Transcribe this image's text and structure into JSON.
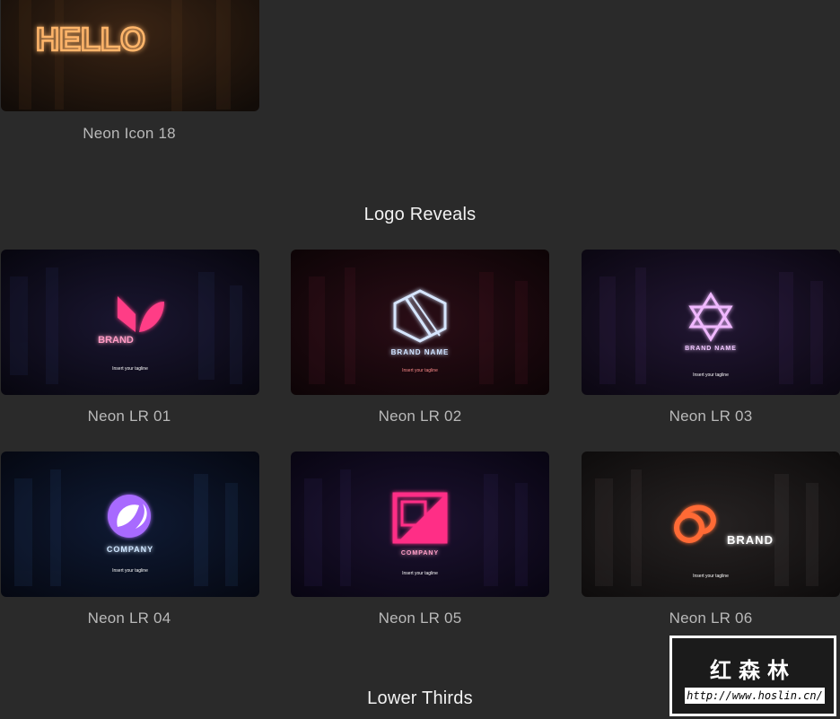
{
  "top_item": {
    "caption": "Neon Icon 18",
    "neon_text": "HELLO"
  },
  "sections": {
    "logo_reveals": "Logo Reveals",
    "lower_thirds": "Lower Thirds"
  },
  "items": [
    {
      "caption": "Neon LR 01",
      "brand": "BRAND",
      "tagline": "Insert your tagline",
      "accent": "#ff3d86"
    },
    {
      "caption": "Neon LR 02",
      "brand": "BRAND NAME",
      "tagline": "Insert your tagline",
      "accent": "#7fb6ff"
    },
    {
      "caption": "Neon LR 03",
      "brand": "BRAND NAME",
      "tagline": "Insert your tagline",
      "accent": "#e27bff"
    },
    {
      "caption": "Neon LR 04",
      "brand": "COMPANY",
      "tagline": "Insert your tagline",
      "accent": "#a86bff"
    },
    {
      "caption": "Neon LR 05",
      "brand": "COMPANY",
      "tagline": "Insert your tagline",
      "accent": "#ff2f86"
    },
    {
      "caption": "Neon LR 06",
      "brand": "BRAND",
      "tagline": "Insert your tagline",
      "accent": "#ff6a35"
    }
  ],
  "watermark": {
    "title": "红森林",
    "url": "http://www.hoslin.cn/"
  },
  "colors": {
    "background": "#2a2a2a",
    "caption": "#b9b9b9",
    "section_title": "#f2f2f2"
  }
}
